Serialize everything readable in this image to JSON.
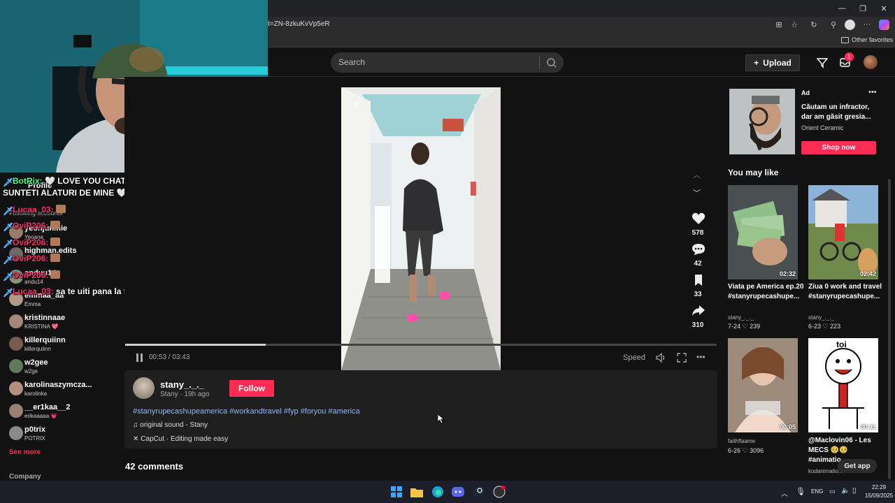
{
  "browser": {
    "url": "t=ZN-8zkuKvVp5eR",
    "other_favorites": "Other favorites",
    "window_controls": [
      "minimize",
      "restore",
      "close"
    ]
  },
  "header": {
    "search_placeholder": "Search",
    "upload_label": "Upload",
    "inbox_badge": "1"
  },
  "chat": {
    "messages": [
      {
        "user": "BotRix:",
        "text": "🤍 LOVE YOU CHAT, VA MULTUMESC CA",
        "continuation": "SUNTETI ALATURI DE MINE 🤍",
        "bot": true
      },
      {
        "user": "Lucaa_03:",
        "text": ""
      },
      {
        "user": "OviP206:",
        "text": ""
      },
      {
        "user": "OviP206:",
        "text": ""
      },
      {
        "user": "OviP206:",
        "text": ""
      },
      {
        "user": "OviP206:",
        "text": ""
      },
      {
        "user": "Lucaa_03:",
        "text": "sa te uiti pana la final"
      }
    ]
  },
  "sidebar": {
    "profile_label": "Profile",
    "following_label": "Following accounts",
    "accounts": [
      {
        "name": "yeonjun.nie",
        "sub": "Yeoana"
      },
      {
        "name": "highman.edits",
        "sub": ""
      },
      {
        "name": "anduu14",
        "sub": "andu14"
      },
      {
        "name": "emmaa_aa",
        "sub": "Emma"
      },
      {
        "name": "kristinnaae",
        "sub": "KRISTINA 💖"
      },
      {
        "name": "killerquiinn",
        "sub": "killerquiinn"
      },
      {
        "name": "w2gee",
        "sub": "w2ge"
      },
      {
        "name": "karolinaszymcza...",
        "sub": "karolinka"
      },
      {
        "name": "__er1kaa__2",
        "sub": "erikaaaaa 💗"
      },
      {
        "name": "p0trix",
        "sub": "POTRIX"
      }
    ],
    "see_more": "See more",
    "company": "Company"
  },
  "video": {
    "elapsed": "00:53",
    "duration": "03:43",
    "progress": 0.238,
    "speed_label": "Speed",
    "actions": {
      "likes": "578",
      "comments": "42",
      "saves": "33",
      "shares": "310"
    }
  },
  "post": {
    "author": "stany_._._",
    "author_display": "Stany",
    "posted": "19h ago",
    "follow_label": "Follow",
    "hashtags": "#stanyrupecashupeamerica #workandtravel #fyp #foryou #america",
    "sound": "original sound - Stany",
    "capcut": "CapCut · Editing made easy",
    "comments_heading": "42 comments"
  },
  "ad": {
    "label": "Ad",
    "title": "Căutam un infractor, dar am găsit gresia...",
    "brand": "Orient Ceramic",
    "cta": "Shop now"
  },
  "recommendations": {
    "heading": "You may like",
    "items": [
      {
        "duration": "02:32",
        "title": "Viata pe America ep.20 #stanyrupecashupe...",
        "author": "stany_._._",
        "date": "7-24",
        "likes": "239"
      },
      {
        "duration": "02:42",
        "title": "Ziua 0 work and travel #stanyrupecashupe...",
        "author": "stany_._._",
        "date": "6-23",
        "likes": "223"
      },
      {
        "duration": "00:05",
        "title": "",
        "author": "faithflaame",
        "date": "6-26",
        "likes": "3096"
      },
      {
        "duration": "00:11",
        "title": "@Maclovin06 - Les MECS 🥺🥺 #animatio...",
        "author": "kodanimatio...",
        "date": "",
        "likes": ""
      }
    ],
    "get_app": "Get app"
  },
  "taskbar": {
    "lang": "ENG",
    "time": "22:29",
    "date": "15/09/2025"
  }
}
